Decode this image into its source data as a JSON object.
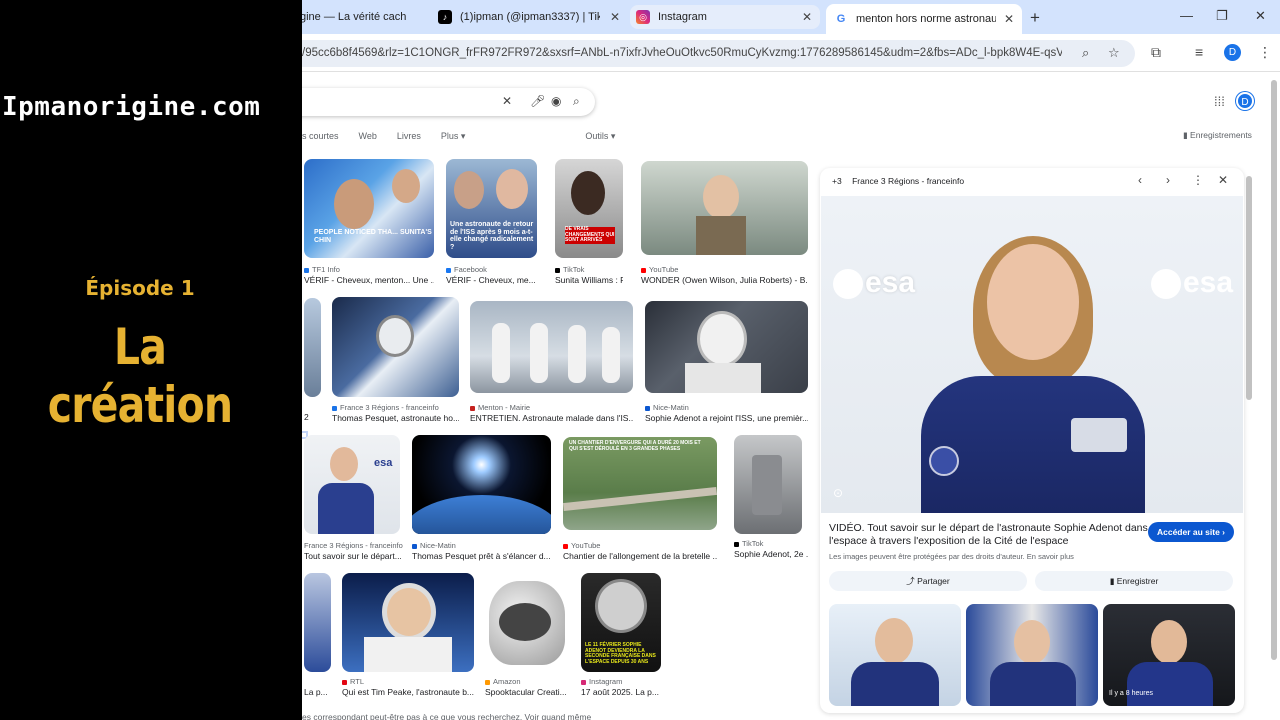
{
  "overlay": {
    "site": "Ipmanorigine.com",
    "episode": "Épisode 1",
    "title": "La création"
  },
  "tabs": [
    {
      "label": "gine — La vérité cach",
      "icon": "page-icon"
    },
    {
      "label": "(1)ipman (@ipman3337) | TikTo",
      "icon": "tiktok-icon"
    },
    {
      "label": "Instagram",
      "icon": "instagram-icon"
    },
    {
      "label": "menton hors norme astronaute",
      "icon": "google-icon"
    }
  ],
  "address": {
    "url": "/95cc6b8f4569&rlz=1C1ONGR_frFR972FR972&sxsrf=ANbL-n7ixfrJvheOuOtkvc50RmuCyKvzmg:1776289586145&udm=2&fbs=ADc_l-bpk8W4E-qsVl..."
  },
  "search": {
    "filters": [
      "s courtes",
      "Web",
      "Livres",
      "Plus ▾",
      "Outils ▾"
    ],
    "saves": "Enregistrements"
  },
  "results": [
    {
      "src": "TF1 Info",
      "cap": "VÉRIF - Cheveux, menton... Une ...",
      "overlay": "PEOPLE NOTICED THA... SUNITA'S CHIN"
    },
    {
      "src": "Facebook",
      "cap": "VÉRIF - Cheveux, me...",
      "overlay": "Une astronaute de retour de l'ISS après 9 mois a-t-elle changé radicalement ?"
    },
    {
      "src": "TikTok",
      "cap": "Sunita Williams : R...",
      "overlay": "DE VRAIS CHANGEMENTS QUI SONT ARRIVÉS"
    },
    {
      "src": "YouTube",
      "cap": "WONDER (Owen Wilson, Julia Roberts) - B...",
      "overlay": ""
    },
    {
      "src": "",
      "cap": "2",
      "overlay": ""
    },
    {
      "src": "France 3 Régions - franceinfo",
      "cap": "Thomas Pesquet, astronaute ho...",
      "overlay": ""
    },
    {
      "src": "Menton - Mairie",
      "cap": "ENTRETIEN. Astronaute malade dans l'IS...",
      "overlay": ""
    },
    {
      "src": "Nice-Matin",
      "cap": "Sophie Adenot a rejoint l'ISS, une premièr...",
      "overlay": ""
    },
    {
      "src": "France 3 Régions - franceinfo",
      "cap": "Tout savoir sur le départ...",
      "overlay": ""
    },
    {
      "src": "Nice-Matin",
      "cap": "Thomas Pesquet prêt à s'élancer d...",
      "overlay": ""
    },
    {
      "src": "YouTube",
      "cap": "Chantier de l'allongement de la bretelle ...",
      "overlay": "UN CHANTIER D'ENVERGURE QUI A DURÉ 20 MOIS ET QUI S'EST DÉROULÉ EN 3 GRANDES PHASES"
    },
    {
      "src": "TikTok",
      "cap": "Sophie Adenot, 2e ...",
      "overlay": ""
    },
    {
      "src": "",
      "cap": "La p...",
      "overlay": ""
    },
    {
      "src": "RTL",
      "cap": "Qui est Tim Peake, l'astronaute b...",
      "overlay": ""
    },
    {
      "src": "Amazon",
      "cap": "Spooktacular Creati...",
      "overlay": ""
    },
    {
      "src": "Instagram",
      "cap": "17 août 2025. La p...",
      "overlay": "LE 11 FÉVRIER SOPHIE ADENOT DEVIENDRA LA SECONDE FRANÇAISE DANS L'ESPACE DEPUIS 30 ANS"
    }
  ],
  "bottom_text": "es correspondant peut-être pas à ce que vous recherchez. Voir quand même",
  "panel": {
    "count": "+3",
    "source": "France 3 Régions - franceinfo",
    "esa_left": "esa",
    "esa_right": "esa",
    "title": "VIDÉO. Tout savoir sur le départ de l'astronaute Sophie Adenot dans l'espace à travers l'exposition de la Cité de l'espace",
    "note": "Les images peuvent être protégées par des droits d'auteur. En savoir plus",
    "visit": "Accéder au site ›",
    "share": "Partager",
    "save": "Enregistrer",
    "thumb3_label": "Il y a 8 heures"
  }
}
